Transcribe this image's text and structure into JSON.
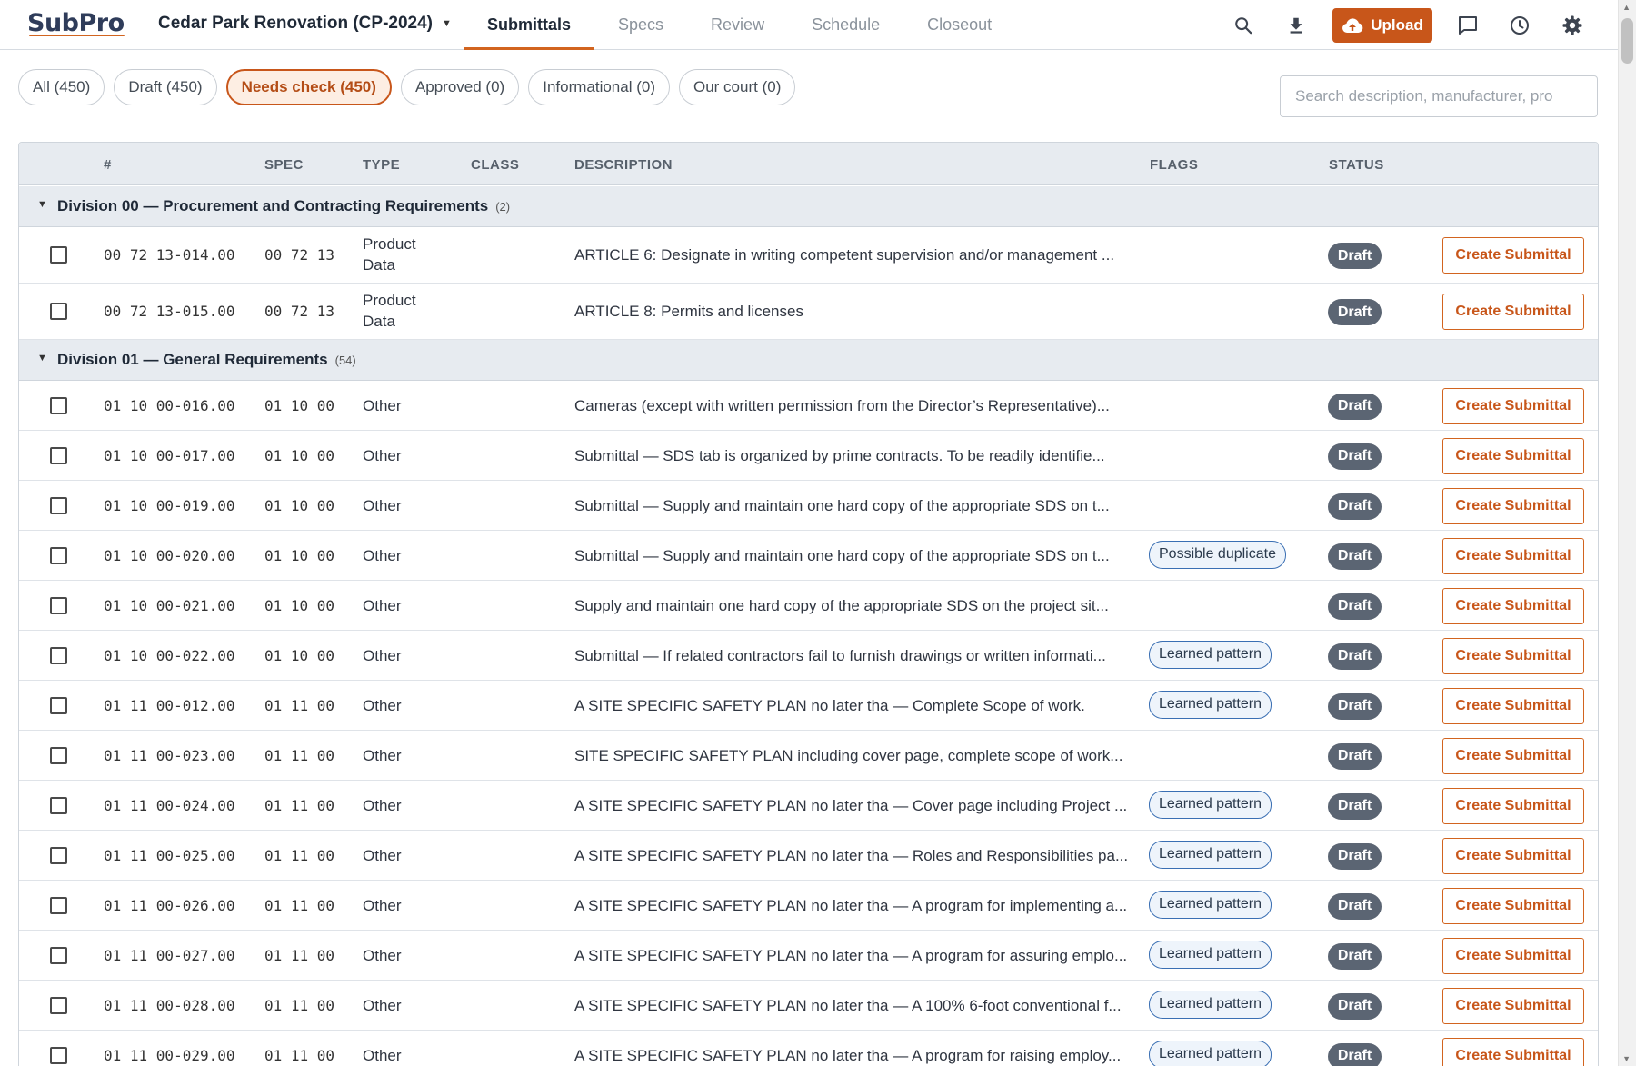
{
  "app": {
    "logo": "SubPro",
    "project": "Cedar Park Renovation (CP-2024)"
  },
  "nav": {
    "tabs": [
      {
        "label": "Submittals",
        "active": true
      },
      {
        "label": "Specs"
      },
      {
        "label": "Review"
      },
      {
        "label": "Schedule"
      },
      {
        "label": "Closeout"
      }
    ],
    "upload_label": "Upload",
    "icons": [
      "search-icon",
      "download-icon",
      "cloud-upload-icon",
      "chat-icon",
      "history-icon",
      "gear-icon"
    ]
  },
  "filters": [
    {
      "label": "All (450)"
    },
    {
      "label": "Draft (450)"
    },
    {
      "label": "Needs check (450)",
      "active": true
    },
    {
      "label": "Approved (0)"
    },
    {
      "label": "Informational (0)"
    },
    {
      "label": "Our court (0)"
    }
  ],
  "search": {
    "placeholder": "Search description, manufacturer, pro",
    "value": ""
  },
  "table": {
    "headers": {
      "num": "#",
      "spec": "SPEC",
      "type": "TYPE",
      "class": "CLASS",
      "description": "DESCRIPTION",
      "flags": "FLAGS",
      "status": "STATUS"
    },
    "action_label": "Create Submittal",
    "groups": [
      {
        "title": "Division 00 — Procurement and Contracting Requirements",
        "count": "(2)",
        "rows": [
          {
            "num": "00 72 13-014.00",
            "spec": "00 72 13",
            "type_line1": "Product",
            "type_line2": "Data",
            "cls": "",
            "desc": "ARTICLE 6: Designate in writing competent supervision and/or management ...",
            "flag": "",
            "status": "Draft"
          },
          {
            "num": "00 72 13-015.00",
            "spec": "00 72 13",
            "type_line1": "Product",
            "type_line2": "Data",
            "cls": "",
            "desc": "ARTICLE 8: Permits and licenses",
            "flag": "",
            "status": "Draft"
          }
        ]
      },
      {
        "title": "Division 01 — General Requirements",
        "count": "(54)",
        "rows": [
          {
            "num": "01 10 00-016.00",
            "spec": "01 10 00",
            "type_line1": "Other",
            "type_line2": "",
            "cls": "",
            "desc": "Cameras (except with written permission from the Director’s Representative)...",
            "flag": "",
            "status": "Draft"
          },
          {
            "num": "01 10 00-017.00",
            "spec": "01 10 00",
            "type_line1": "Other",
            "type_line2": "",
            "cls": "",
            "desc": "Submittal — SDS tab is organized by prime contracts. To be readily identifie...",
            "flag": "",
            "status": "Draft"
          },
          {
            "num": "01 10 00-019.00",
            "spec": "01 10 00",
            "type_line1": "Other",
            "type_line2": "",
            "cls": "",
            "desc": "Submittal — Supply and maintain one hard copy of the appropriate SDS on t...",
            "flag": "",
            "status": "Draft"
          },
          {
            "num": "01 10 00-020.00",
            "spec": "01 10 00",
            "type_line1": "Other",
            "type_line2": "",
            "cls": "",
            "desc": "Submittal — Supply and maintain one hard copy of the appropriate SDS on t...",
            "flag": "Possible duplicate",
            "status": "Draft"
          },
          {
            "num": "01 10 00-021.00",
            "spec": "01 10 00",
            "type_line1": "Other",
            "type_line2": "",
            "cls": "",
            "desc": "Supply and maintain one hard copy of the appropriate SDS on the project sit...",
            "flag": "",
            "status": "Draft"
          },
          {
            "num": "01 10 00-022.00",
            "spec": "01 10 00",
            "type_line1": "Other",
            "type_line2": "",
            "cls": "",
            "desc": "Submittal — If related contractors fail to furnish drawings or written informati...",
            "flag": "Learned pattern",
            "status": "Draft"
          },
          {
            "num": "01 11 00-012.00",
            "spec": "01 11 00",
            "type_line1": "Other",
            "type_line2": "",
            "cls": "",
            "desc": "A SITE SPECIFIC SAFETY PLAN no later tha — Complete Scope of work.",
            "flag": "Learned pattern",
            "status": "Draft"
          },
          {
            "num": "01 11 00-023.00",
            "spec": "01 11 00",
            "type_line1": "Other",
            "type_line2": "",
            "cls": "",
            "desc": "SITE SPECIFIC SAFETY PLAN including cover page, complete scope of work...",
            "flag": "",
            "status": "Draft"
          },
          {
            "num": "01 11 00-024.00",
            "spec": "01 11 00",
            "type_line1": "Other",
            "type_line2": "",
            "cls": "",
            "desc": "A SITE SPECIFIC SAFETY PLAN no later tha — Cover page including Project ...",
            "flag": "Learned pattern",
            "status": "Draft"
          },
          {
            "num": "01 11 00-025.00",
            "spec": "01 11 00",
            "type_line1": "Other",
            "type_line2": "",
            "cls": "",
            "desc": "A SITE SPECIFIC SAFETY PLAN no later tha — Roles and Responsibilities pa...",
            "flag": "Learned pattern",
            "status": "Draft"
          },
          {
            "num": "01 11 00-026.00",
            "spec": "01 11 00",
            "type_line1": "Other",
            "type_line2": "",
            "cls": "",
            "desc": "A SITE SPECIFIC SAFETY PLAN no later tha — A program for implementing a...",
            "flag": "Learned pattern",
            "status": "Draft"
          },
          {
            "num": "01 11 00-027.00",
            "spec": "01 11 00",
            "type_line1": "Other",
            "type_line2": "",
            "cls": "",
            "desc": "A SITE SPECIFIC SAFETY PLAN no later tha — A program for assuring emplo...",
            "flag": "Learned pattern",
            "status": "Draft"
          },
          {
            "num": "01 11 00-028.00",
            "spec": "01 11 00",
            "type_line1": "Other",
            "type_line2": "",
            "cls": "",
            "desc": "A SITE SPECIFIC SAFETY PLAN no later tha — A 100% 6-foot conventional f...",
            "flag": "Learned pattern",
            "status": "Draft"
          },
          {
            "num": "01 11 00-029.00",
            "spec": "01 11 00",
            "type_line1": "Other",
            "type_line2": "",
            "cls": "",
            "desc": "A SITE SPECIFIC SAFETY PLAN no later tha — A program for raising employ...",
            "flag": "Learned pattern",
            "status": "Draft"
          }
        ]
      }
    ]
  },
  "colors": {
    "accent": "#c8561a",
    "status_draft": "#5b6573",
    "flag_border": "#3a6fb3",
    "header_bg": "#e7ebf0"
  }
}
